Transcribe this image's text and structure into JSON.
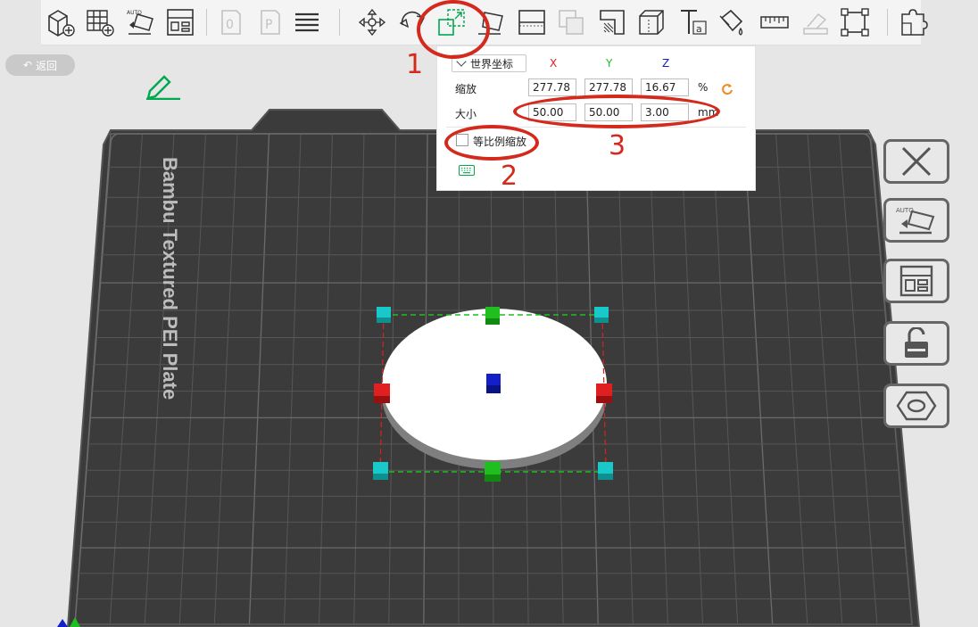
{
  "toolbar": {
    "tools": [
      {
        "id": "add-object",
        "icon": "cube-plus-icon"
      },
      {
        "id": "add-plate",
        "icon": "grid-plus-icon"
      },
      {
        "id": "auto-orient",
        "icon": "auto-orient-icon",
        "badge": "AUTO"
      },
      {
        "id": "arrange",
        "icon": "arrange-icon"
      },
      {
        "id": "copy",
        "icon": "copy-icon",
        "disabled": true
      },
      {
        "id": "paste",
        "icon": "paste-icon",
        "disabled": true
      },
      {
        "id": "layers",
        "icon": "layers-icon"
      },
      {
        "id": "move",
        "icon": "move-icon"
      },
      {
        "id": "rotate",
        "icon": "rotate-icon"
      },
      {
        "id": "scale",
        "icon": "scale-icon",
        "active": true
      },
      {
        "id": "lay-on-face",
        "icon": "lay-on-face-icon"
      },
      {
        "id": "cut",
        "icon": "cut-icon"
      },
      {
        "id": "boolean",
        "icon": "boolean-icon",
        "disabled": true
      },
      {
        "id": "support-paint",
        "icon": "support-paint-icon"
      },
      {
        "id": "seam-paint",
        "icon": "seam-paint-icon"
      },
      {
        "id": "text",
        "icon": "text-icon",
        "label": "T",
        "sublabel": "a"
      },
      {
        "id": "color-paint",
        "icon": "paint-bucket-icon"
      },
      {
        "id": "measure",
        "icon": "ruler-icon"
      },
      {
        "id": "assembly",
        "icon": "assembly-icon",
        "disabled": true
      },
      {
        "id": "scale-fit",
        "icon": "fit-frame-icon"
      },
      {
        "id": "split",
        "icon": "puzzle-icon"
      }
    ]
  },
  "back": {
    "label": "返回"
  },
  "scale_panel": {
    "coord_system": "世界坐标",
    "axes": {
      "x": "X",
      "y": "Y",
      "z": "Z"
    },
    "scale": {
      "label": "缩放",
      "x": "277.78",
      "y": "277.78",
      "z": "16.67",
      "unit": "%"
    },
    "size": {
      "label": "大小",
      "x": "50.00",
      "y": "50.00",
      "z": "3.00",
      "unit": "mm"
    },
    "uniform_scale": {
      "label": "等比例缩放",
      "checked": false
    }
  },
  "plate": {
    "name": "Bambu Textured PEI Plate"
  },
  "annotations": {
    "one": "1",
    "two": "2",
    "three": "3"
  },
  "side_buttons": [
    {
      "id": "delete",
      "icon": "close-x-icon"
    },
    {
      "id": "auto-orient",
      "icon": "auto-orient-icon",
      "badge": "AUTO"
    },
    {
      "id": "arrange",
      "icon": "arrange-icon"
    },
    {
      "id": "lock",
      "icon": "unlock-icon"
    },
    {
      "id": "settings",
      "icon": "hex-nut-icon"
    }
  ],
  "colors": {
    "accent": "#00a84f",
    "annotation": "#d42a1e",
    "plate": "#3a3a3a",
    "grid": "#5c5c5c",
    "axis_x": "#e02020",
    "axis_y": "#1fbf1f",
    "axis_z": "#1320c8",
    "corner_handle": "#19c9c9",
    "reset": "#f08a24"
  }
}
